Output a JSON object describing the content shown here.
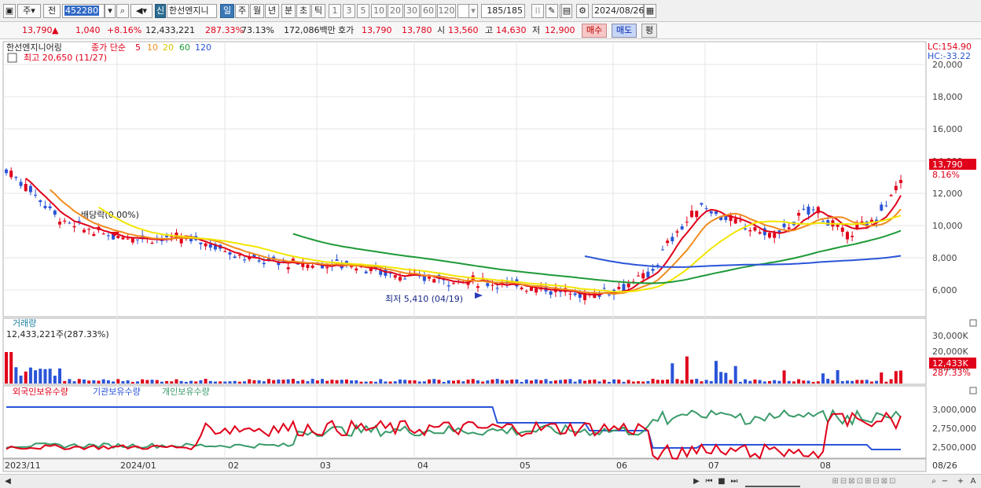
{
  "toolbar": {
    "type_label": "주",
    "prev_label": "전",
    "code": "452280",
    "new_badge": "신",
    "stock_name": "한선엔지니",
    "periods": [
      "일",
      "주",
      "월",
      "년",
      "분",
      "초",
      "틱"
    ],
    "active_period": "일",
    "nums": [
      "1",
      "3",
      "5",
      "10",
      "20",
      "30",
      "60",
      "120"
    ],
    "count": "185",
    "count_total": "/185",
    "date": "2024/08/26"
  },
  "quote": {
    "price": "13,790",
    "change_arrow": "▲",
    "change": "1,040",
    "change_pct": "+8.16%",
    "volume": "12,433,221",
    "volume_ratio": "287.33%",
    "turnover": "73.13%",
    "amount": "172,086백만",
    "hoga_label": "호가",
    "ask": "13,790",
    "bid": "13,780",
    "open_label": "시",
    "open": "13,560",
    "high_label": "고",
    "high": "14,630",
    "low_label": "저",
    "low": "12,900",
    "buy_label": "매수",
    "sell_label": "매도",
    "eval_label": "평"
  },
  "price_panel": {
    "title": "한선엔지니어링",
    "ma_label": "종가 단순",
    "ma_periods": [
      "5",
      "10",
      "20",
      "60",
      "120"
    ],
    "ma_colors": [
      "#e0001a",
      "#f08c1e",
      "#f2e600",
      "#1e9a38",
      "#2a54d8"
    ],
    "high_note": "최고 20,650 (11/27)",
    "low_note": "최저 5,410 (04/19)",
    "dividend_note": "배당락(0.00%)",
    "lc": "LC:154.90",
    "hc": "HC:-33.22",
    "y_ticks": [
      "20,000",
      "18,000",
      "16,000",
      "14,000",
      "12,000",
      "10,000",
      "8,000",
      "6,000"
    ],
    "last_price_tag": "13,790",
    "last_pct_tag": "8.16%"
  },
  "volume_panel": {
    "title": "거래량",
    "info": "12,433,221주(287.33%)",
    "y_ticks": [
      "30,000K",
      "20,000K",
      "10,000K"
    ],
    "last_tag": "12,433K",
    "last_pct": "287.33%"
  },
  "holding_panel": {
    "series": [
      "외국인보유수량",
      "기관보유수량",
      "개인보유수량"
    ],
    "series_colors": [
      "#e0001a",
      "#2a54d8",
      "#3a9a6a"
    ],
    "y_ticks": [
      "3,000,000",
      "2,750,000",
      "2,500,000"
    ]
  },
  "x_axis": {
    "labels": [
      "2023/11",
      "2024/01",
      "02",
      "03",
      "04",
      "05",
      "06",
      "07",
      "08"
    ],
    "right_label": "08/26"
  },
  "chart_data": {
    "type": "line",
    "title": "한선엔지니어링",
    "x": [
      "2023/11",
      "2024/01",
      "02",
      "03",
      "04",
      "05",
      "06",
      "07",
      "08",
      "08/26"
    ],
    "series": [
      {
        "name": "종가",
        "values": [
          13000,
          9300,
          7600,
          6600,
          5800,
          7000,
          10200,
          9800,
          10400,
          13790
        ]
      }
    ],
    "ylim": [
      5000,
      21000
    ],
    "max": {
      "value": 20650,
      "date": "11/27"
    },
    "min": {
      "value": 5410,
      "date": "04/19"
    },
    "last": 13790
  }
}
